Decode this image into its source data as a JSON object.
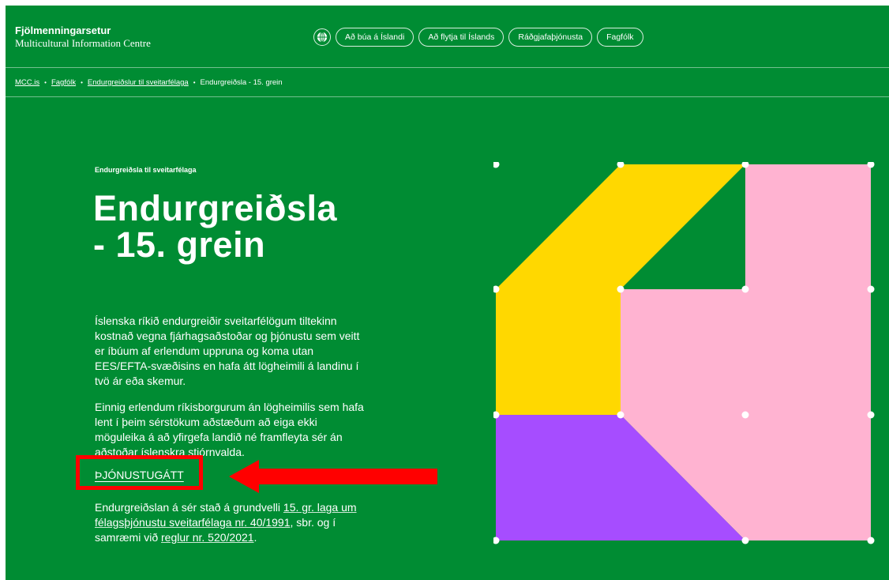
{
  "header": {
    "site_name": "Fjölmenningarsetur",
    "site_subtitle": "Multicultural Information Centre",
    "nav": [
      {
        "label": "Að búa á Íslandi"
      },
      {
        "label": "Að flytja til Íslands"
      },
      {
        "label": "Ráðgjafaþjónusta"
      },
      {
        "label": "Fagfólk"
      }
    ],
    "language_icon": "globe-icon"
  },
  "breadcrumb": {
    "items": [
      "MCC.is",
      "Fagfólk",
      "Endurgreiðslur til sveitarfélaga"
    ],
    "current": "Endurgreiðsla - 15. grein",
    "separator": "•"
  },
  "main": {
    "eyebrow": "Endurgreiðsla til sveitarfélaga",
    "title": "Endurgreiðsla - 15. grein",
    "paragraph1": "Íslenska ríkið endurgreiðir sveitarfélögum tiltekinn kostnað vegna fjárhagsaðstoðar og þjónustu sem veitt er íbúum af erlendum uppruna og koma utan EES/EFTA-svæðisins en hafa átt lögheimili á landinu í tvö ár eða skemur.",
    "paragraph2": "Einnig erlendum ríkisborgurum án lögheimilis sem hafa lent í þeim sérstökum aðstæðum að eiga ekki möguleika á að yfirgefa landið né framfleyta sér án aðstoðar íslenskra stjórnvalda.",
    "service_link": "ÞJÓNUSTUGÁTT",
    "paragraph3": {
      "before": "Endurgreiðslan á sér stað á grundvelli ",
      "link1": "15. gr. laga um félagsþjónustu sveitarfélaga nr. 40/1991",
      "middle": ", sbr. og í samræmi við ",
      "link2": "reglur nr. 520/2021",
      "after": "."
    }
  },
  "colors": {
    "background": "#008c33",
    "art_yellow": "#ffd800",
    "art_pink": "#ffb3d1",
    "art_purple": "#a64dff",
    "annotation_red": "#ff0000"
  }
}
